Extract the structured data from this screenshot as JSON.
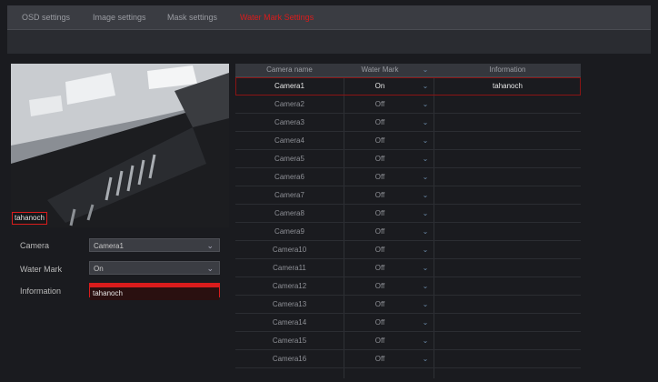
{
  "tabs": [
    {
      "label": "OSD settings",
      "active": false
    },
    {
      "label": "Image settings",
      "active": false
    },
    {
      "label": "Mask settings",
      "active": false
    },
    {
      "label": "Water Mark Settings",
      "active": true
    }
  ],
  "preview": {
    "overlay_text": "tahanoch"
  },
  "form": {
    "camera_label": "Camera",
    "camera_value": "Camera1",
    "watermark_label": "Water Mark",
    "watermark_value": "On",
    "information_label": "Information",
    "information_value": "tahanoch"
  },
  "table": {
    "headers": {
      "camera": "Camera name",
      "watermark": "Water Mark",
      "information": "Information"
    },
    "rows": [
      {
        "camera": "Camera1",
        "watermark": "On",
        "information": "tahanoch"
      },
      {
        "camera": "Camera2",
        "watermark": "Off",
        "information": ""
      },
      {
        "camera": "Camera3",
        "watermark": "Off",
        "information": ""
      },
      {
        "camera": "Camera4",
        "watermark": "Off",
        "information": ""
      },
      {
        "camera": "Camera5",
        "watermark": "Off",
        "information": ""
      },
      {
        "camera": "Camera6",
        "watermark": "Off",
        "information": ""
      },
      {
        "camera": "Camera7",
        "watermark": "Off",
        "information": ""
      },
      {
        "camera": "Camera8",
        "watermark": "Off",
        "information": ""
      },
      {
        "camera": "Camera9",
        "watermark": "Off",
        "information": ""
      },
      {
        "camera": "Camera10",
        "watermark": "Off",
        "information": ""
      },
      {
        "camera": "Camera11",
        "watermark": "Off",
        "information": ""
      },
      {
        "camera": "Camera12",
        "watermark": "Off",
        "information": ""
      },
      {
        "camera": "Camera13",
        "watermark": "Off",
        "information": ""
      },
      {
        "camera": "Camera14",
        "watermark": "Off",
        "information": ""
      },
      {
        "camera": "Camera15",
        "watermark": "Off",
        "information": ""
      },
      {
        "camera": "Camera16",
        "watermark": "Off",
        "information": ""
      }
    ]
  },
  "colors": {
    "accent": "#d91c1c",
    "background": "#1a1b1f",
    "tabbar": "#3a3c42"
  }
}
